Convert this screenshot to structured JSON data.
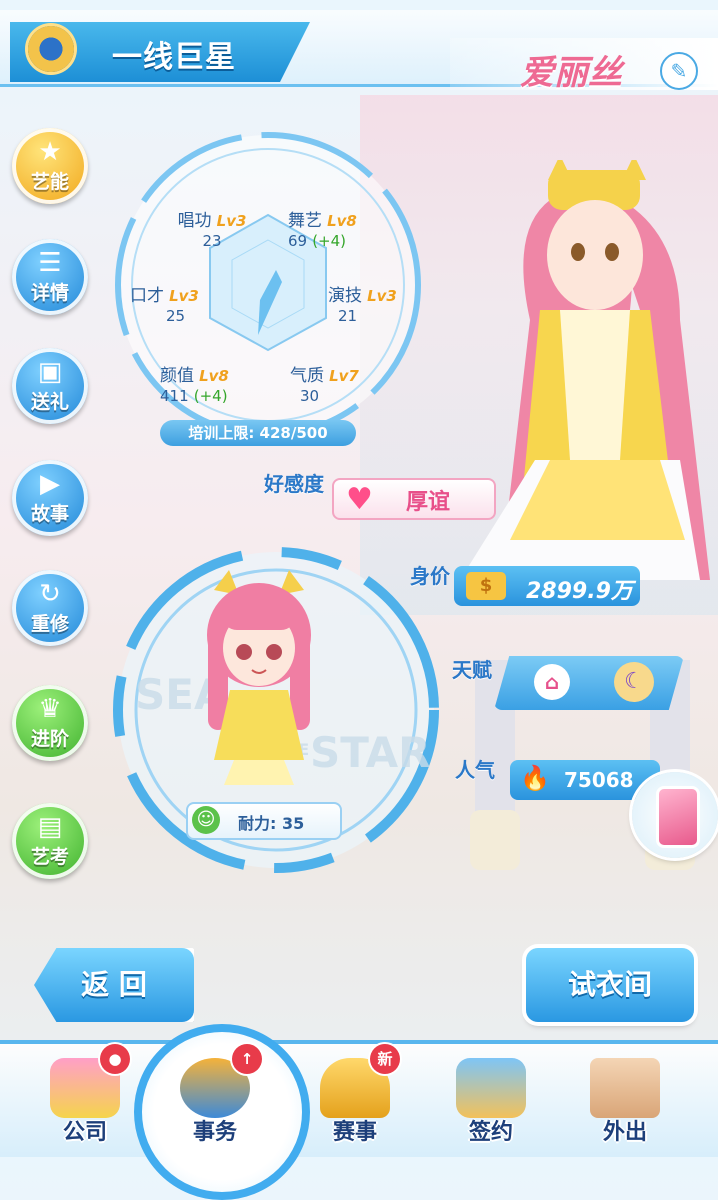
{
  "header": {
    "title": "一线巨星",
    "character_name": "爱丽丝",
    "edit_icon": "pencil-icon"
  },
  "side_menu": [
    {
      "label": "艺能",
      "icon": "star-icon",
      "style": "gold"
    },
    {
      "label": "详情",
      "icon": "list-icon",
      "style": "blue"
    },
    {
      "label": "送礼",
      "icon": "gift-icon",
      "style": "blue"
    },
    {
      "label": "故事",
      "icon": "play-icon",
      "style": "blue"
    },
    {
      "label": "重修",
      "icon": "refresh-icon",
      "style": "blue"
    },
    {
      "label": "进阶",
      "icon": "crown-icon",
      "style": "green"
    },
    {
      "label": "艺考",
      "icon": "book-icon",
      "style": "green"
    }
  ],
  "stats": {
    "singing": {
      "name": "唱功",
      "level": "Lv3",
      "value": "23",
      "bonus": ""
    },
    "dance": {
      "name": "舞艺",
      "level": "Lv8",
      "value": "69",
      "bonus": "(+4)"
    },
    "eloquence": {
      "name": "口才",
      "level": "Lv3",
      "value": "25",
      "bonus": ""
    },
    "acting": {
      "name": "演技",
      "level": "Lv3",
      "value": "21",
      "bonus": ""
    },
    "looks": {
      "name": "颜值",
      "level": "Lv8",
      "value": "411",
      "bonus": "(+4)"
    },
    "temperament": {
      "name": "气质",
      "level": "Lv7",
      "value": "30",
      "bonus": ""
    },
    "training_limit": "培训上限: 428/500"
  },
  "affection": {
    "label": "好感度",
    "value": "厚谊",
    "icon": "heart-icon"
  },
  "stamina": {
    "label": "耐力: 35",
    "icon": "smiley-icon"
  },
  "info": {
    "worth_label": "身价",
    "worth_value": "2899.9万",
    "talent_label": "天赋",
    "popularity_label": "人气",
    "popularity_value": "75068"
  },
  "watermark": {
    "line1": "SEA",
    "line2": "STAR",
    "small": "THE"
  },
  "buttons": {
    "back": "返 回",
    "fitting_room": "试衣间"
  },
  "bottom_nav": [
    {
      "label": "公司",
      "icon": "shop-icon",
      "badge": "person-badge"
    },
    {
      "label": "事务",
      "icon": "manager-icon",
      "badge": "up-arrow-badge"
    },
    {
      "label": "赛事",
      "icon": "trophy-icon",
      "badge": "新"
    },
    {
      "label": "签约",
      "icon": "contract-icon",
      "badge": ""
    },
    {
      "label": "外出",
      "icon": "door-icon",
      "badge": ""
    }
  ],
  "colors": {
    "primary_blue": "#2a93dd",
    "name_pink": "#ee6a93",
    "level_gold": "#f0a11d",
    "bonus_green": "#35a62b"
  }
}
